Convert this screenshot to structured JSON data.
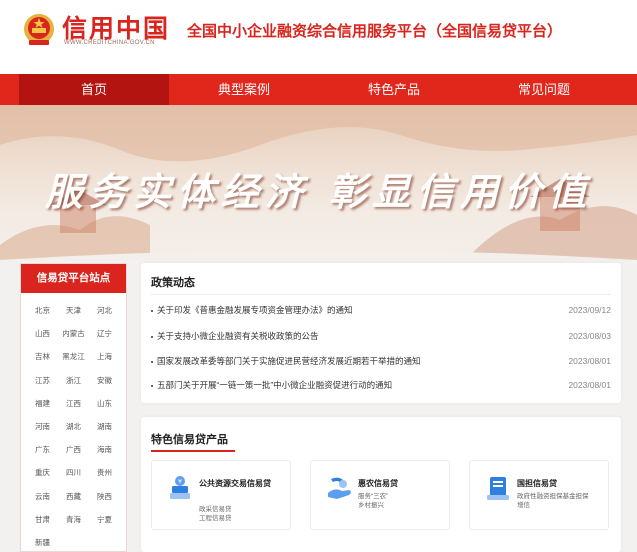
{
  "header": {
    "logo_text": "信用中国",
    "logo_url": "WWW.CREDITCHINA.GOV.CN",
    "platform_title": "全国中小企业融资综合信用服务平台（全国信易贷平台）"
  },
  "nav": {
    "items": [
      {
        "label": "首页",
        "active": true
      },
      {
        "label": "典型案例",
        "active": false
      },
      {
        "label": "特色产品",
        "active": false
      },
      {
        "label": "常见问题",
        "active": false
      }
    ]
  },
  "banner": {
    "slogan": "服务实体经济 彰显信用价值"
  },
  "sites": {
    "title": "信易贷平台站点",
    "items": [
      "北京",
      "天津",
      "河北",
      "山西",
      "内蒙古",
      "辽宁",
      "吉林",
      "黑龙江",
      "上海",
      "江苏",
      "浙江",
      "安徽",
      "福建",
      "江西",
      "山东",
      "河南",
      "湖北",
      "湖南",
      "广东",
      "广西",
      "海南",
      "重庆",
      "四川",
      "贵州",
      "云南",
      "西藏",
      "陕西",
      "甘肃",
      "青海",
      "宁夏",
      "新疆"
    ]
  },
  "policy": {
    "title": "政策动态",
    "items": [
      {
        "text": "关于印发《普惠金融发展专项资金管理办法》的通知",
        "date": "2023/09/12"
      },
      {
        "text": "关于支持小微企业融资有关税收政策的公告",
        "date": "2023/08/03"
      },
      {
        "text": "国家发展改革委等部门关于实施促进民营经济发展近期若干举措的通知",
        "date": "2023/08/01"
      },
      {
        "text": "五部门关于开展“一链一策一批”中小微企业融资促进行动的通知",
        "date": "2023/08/01"
      }
    ]
  },
  "products": {
    "title": "特色信易贷产品",
    "items": [
      {
        "name": "公共资源交易信易贷",
        "desc": [
          "政采信易贷",
          "工程信易贷"
        ],
        "icon": "stack-coin-icon",
        "color": "#2f7fe0"
      },
      {
        "name": "惠农信易贷",
        "desc": [
          "服务“三农”",
          "乡村振兴"
        ],
        "icon": "hand-coin-icon",
        "color": "#2f7fe0"
      },
      {
        "name": "国担信易贷",
        "desc": [
          "政府性融资担保基金担保",
          "增信"
        ],
        "icon": "guarantee-icon",
        "color": "#2f7fe0"
      }
    ]
  },
  "colors": {
    "brand_red": "#d9251d",
    "nav_active": "#b3140f",
    "icon_blue": "#2f7fe0"
  }
}
